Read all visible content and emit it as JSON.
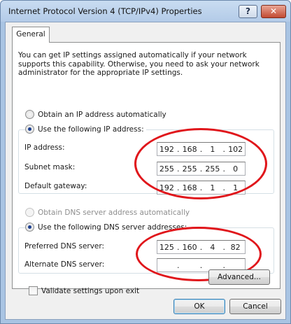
{
  "window": {
    "title": "Internet Protocol Version 4 (TCP/IPv4) Properties",
    "help_label": "?",
    "close_label": "✕"
  },
  "tabs": [
    {
      "label": "General",
      "selected": true
    }
  ],
  "intro": "You can get IP settings assigned automatically if your network supports this capability. Otherwise, you need to ask your network administrator for the appropriate IP settings.",
  "ip_section": {
    "auto_label": "Obtain an IP address automatically",
    "manual_label": "Use the following IP address:",
    "selected": "manual",
    "fields": [
      {
        "label": "IP address:",
        "octets": [
          "192",
          "168",
          "1",
          "102"
        ]
      },
      {
        "label": "Subnet mask:",
        "octets": [
          "255",
          "255",
          "255",
          "0"
        ]
      },
      {
        "label": "Default gateway:",
        "octets": [
          "192",
          "168",
          "1",
          "1"
        ]
      }
    ]
  },
  "dns_section": {
    "auto_label": "Obtain DNS server address automatically",
    "manual_label": "Use the following DNS server addresses:",
    "selected": "manual",
    "fields": [
      {
        "label": "Preferred DNS server:",
        "octets": [
          "125",
          "160",
          "4",
          "82"
        ]
      },
      {
        "label": "Alternate DNS server:",
        "octets": [
          "",
          "",
          "",
          ""
        ]
      }
    ]
  },
  "validate_label": "Validate settings upon exit",
  "validate_checked": false,
  "buttons": {
    "advanced": "Advanced...",
    "ok": "OK",
    "cancel": "Cancel"
  },
  "colors": {
    "highlight_ring": "#e0161b",
    "title_bar": "#b3cbe8",
    "close_button": "#c24a32"
  }
}
